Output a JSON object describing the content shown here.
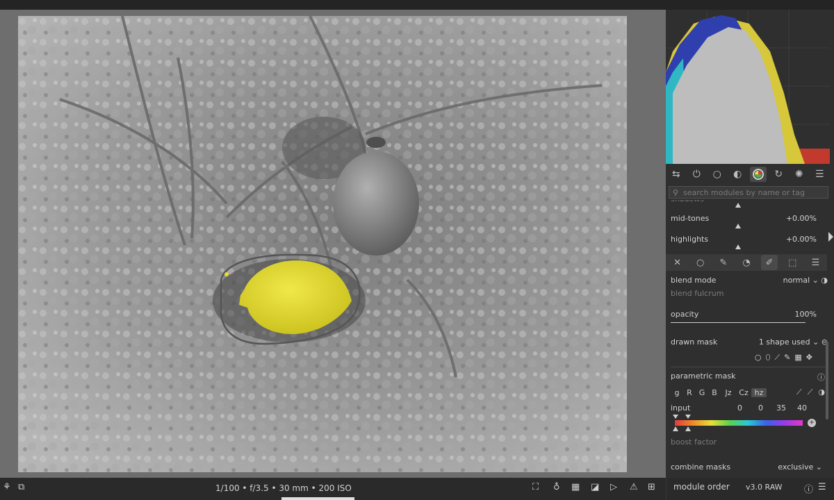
{
  "image_info": {
    "exif": "1/100 • f/3.5 • 30 mm • 200 ISO"
  },
  "search": {
    "placeholder": "search modules by name or tag"
  },
  "module_tabs": [
    {
      "icon": "quick-access-icon"
    },
    {
      "icon": "power-icon"
    },
    {
      "icon": "circle-icon"
    },
    {
      "icon": "tone-icon"
    },
    {
      "icon": "color-wheel-icon"
    },
    {
      "icon": "correct-icon"
    },
    {
      "icon": "effects-icon"
    },
    {
      "icon": "menu-icon"
    }
  ],
  "tone": {
    "cutoff_label": "shadows",
    "midtones": {
      "label": "mid-tones",
      "value": "+0.00%"
    },
    "highlights": {
      "label": "highlights",
      "value": "+0.00%"
    }
  },
  "blend": {
    "blend_mode_label": "blend mode",
    "blend_mode_value": "normal",
    "blend_fulcrum_label": "blend fulcrum",
    "opacity_label": "opacity",
    "opacity_value": "100%",
    "opacity_fraction": 1.0,
    "drawn_mask_label": "drawn mask",
    "drawn_mask_value": "1 shape used",
    "parametric_mask_label": "parametric mask",
    "channels": [
      "g",
      "R",
      "G",
      "B",
      "Jz",
      "Cz",
      "hz"
    ],
    "active_channel": "hz",
    "input_label": "input",
    "input_values": [
      "0",
      "0",
      "35",
      "40"
    ],
    "boost_factor_label": "boost factor",
    "combine_masks_label": "combine masks",
    "combine_masks_value": "exclusive"
  },
  "bottom": {
    "module_order_label": "module order",
    "version": "v3.0 RAW"
  },
  "colors": {
    "accent_yellow": "#e9e02e",
    "panel_bg": "#2f2f2f"
  }
}
